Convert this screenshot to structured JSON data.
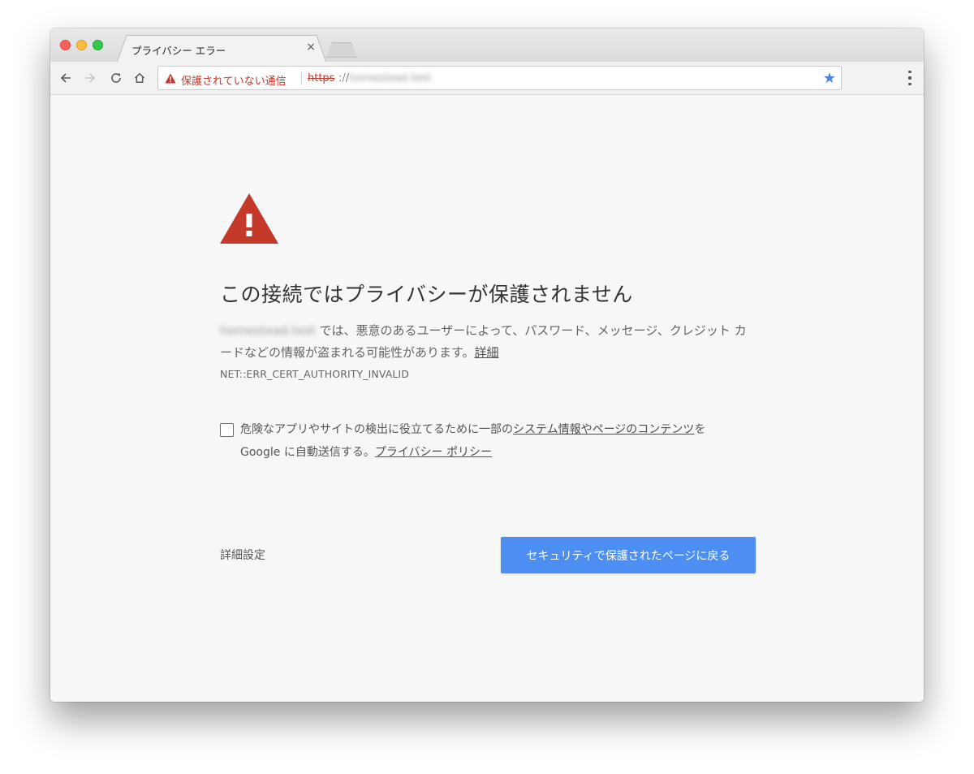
{
  "browser": {
    "tab_title": "プライバシー エラー",
    "tab_close": "×",
    "security_chip": "保護されていない通信",
    "url_scheme": "https",
    "url_sep": "://",
    "url_host": "homestead.test"
  },
  "page": {
    "heading": "この接続ではプライバシーが保護されません",
    "body_host": "homestead.test",
    "body_text": " では、悪意のあるユーザーによって、パスワード、メッセージ、クレジット カードなどの情報が盗まれる可能性があります。",
    "details_link": "詳細",
    "error_code": "NET::ERR_CERT_AUTHORITY_INVALID",
    "checkbox_text_1": "危険なアプリやサイトの検出に役立てるために一部の",
    "checkbox_link_1": "システム情報やページのコンテンツ",
    "checkbox_text_2": "を",
    "checkbox_text_3": "Google に自動送信する。",
    "checkbox_link_2": "プライバシー ポリシー",
    "advanced_label": "詳細設定",
    "back_button": "セキュリティで保護されたページに戻る"
  },
  "colors": {
    "warning_red": "#c5392b",
    "primary_blue": "#4d8ef2",
    "star_blue": "#4a86e8"
  },
  "icons": [
    "back-arrow-icon",
    "forward-arrow-icon",
    "reload-icon",
    "home-icon",
    "warning-icon",
    "bookmark-star-icon",
    "menu-dots-icon"
  ]
}
